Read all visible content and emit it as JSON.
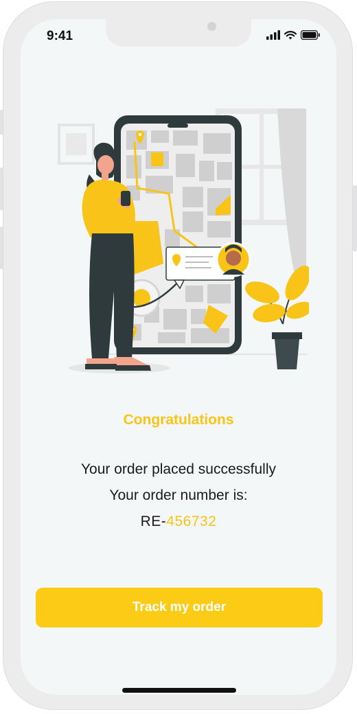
{
  "status_bar": {
    "time": "9:41",
    "icons": [
      "signal-icon",
      "wifi-icon",
      "battery-icon"
    ]
  },
  "illustration": {
    "name": "delivery-map-illustration"
  },
  "content": {
    "title": "Congratulations",
    "line1": "Your order placed successfully",
    "line2": "Your order number is:",
    "order_prefix": "RE-",
    "order_number": "456732"
  },
  "cta": {
    "label": "Track my order"
  },
  "colors": {
    "accent": "#fccb15",
    "title": "#f8c417",
    "background": "#f4f7f7",
    "text": "#1a1a1a"
  }
}
